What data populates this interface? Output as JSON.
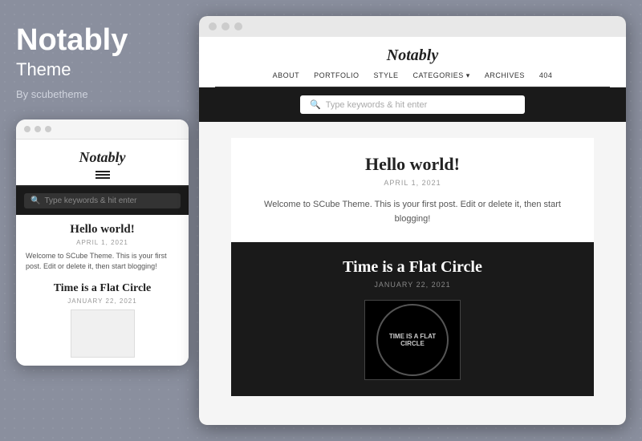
{
  "left": {
    "title": "Notably",
    "subtitle": "Theme",
    "author": "By scubetheme"
  },
  "mobile": {
    "site_title": "Notably",
    "search_placeholder": "Type keywords & hit enter",
    "posts": [
      {
        "title": "Hello world!",
        "date": "APRIL 1, 2021",
        "excerpt": "Welcome to SCube Theme. This is your first post. Edit or delete it, then start blogging!"
      },
      {
        "title": "Time is a Flat Circle",
        "date": "JANUARY 22, 2021",
        "excerpt": ""
      }
    ]
  },
  "desktop": {
    "site_title": "Notably",
    "nav": [
      "ABOUT",
      "PORTFOLIO",
      "STYLE",
      "CATEGORIES ▾",
      "ARCHIVES",
      "404"
    ],
    "search_placeholder": "Type keywords & hit enter",
    "posts": [
      {
        "title": "Hello world!",
        "date": "APRIL 1, 2021",
        "excerpt": "Welcome to SCube Theme. This is your first post. Edit or delete it, then start blogging!"
      },
      {
        "title": "Time is a Flat Circle",
        "date": "JANUARY 22, 2021",
        "image_text": "TIME IS A FLAT CIRCLE"
      }
    ]
  },
  "colors": {
    "background": "#8a8f9e",
    "text_light": "#ffffff",
    "text_dark": "#222222"
  }
}
